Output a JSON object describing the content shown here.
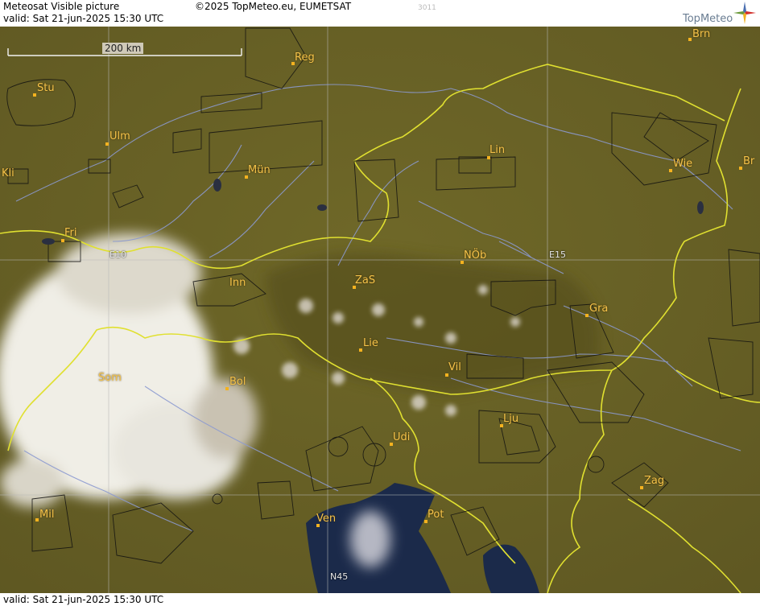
{
  "header": {
    "product": "Meteosat Visible picture",
    "valid_line": "valid:  Sat  21-jun-2025  15:30 UTC",
    "copyright": "©2025 TopMeteo.eu, EUMETSAT",
    "code": "3011",
    "brand": "TopMeteo"
  },
  "footer": {
    "valid_line": "valid:  Sat  21-jun-2025  15:30 UTC"
  },
  "scale": {
    "label": "200 km"
  },
  "grid_labels": {
    "e10": "E10",
    "e15": "E15",
    "n45": "N45"
  },
  "cities": {
    "brn": "Brn",
    "reg": "Reg",
    "stu": "Stu",
    "ulm": "Ulm",
    "mun": "Mün",
    "lin": "Lin",
    "wie": "Wie",
    "br": "Br",
    "kli": "Kli",
    "fri": "Fri",
    "nob": "NÖb",
    "inn": "Inn",
    "zas": "ZaS",
    "gra": "Gra",
    "lie": "Lie",
    "vil": "Vil",
    "som": "Som",
    "bol": "Bol",
    "lju": "Lju",
    "udi": "Udi",
    "zag": "Zag",
    "mil": "Mil",
    "ven": "Ven",
    "pot": "Pot"
  },
  "colors": {
    "land": "#6b6227",
    "sea": "#1b2a4a",
    "border": "#e0e030",
    "river": "#8c9ad0",
    "city": "#f4c24a"
  }
}
